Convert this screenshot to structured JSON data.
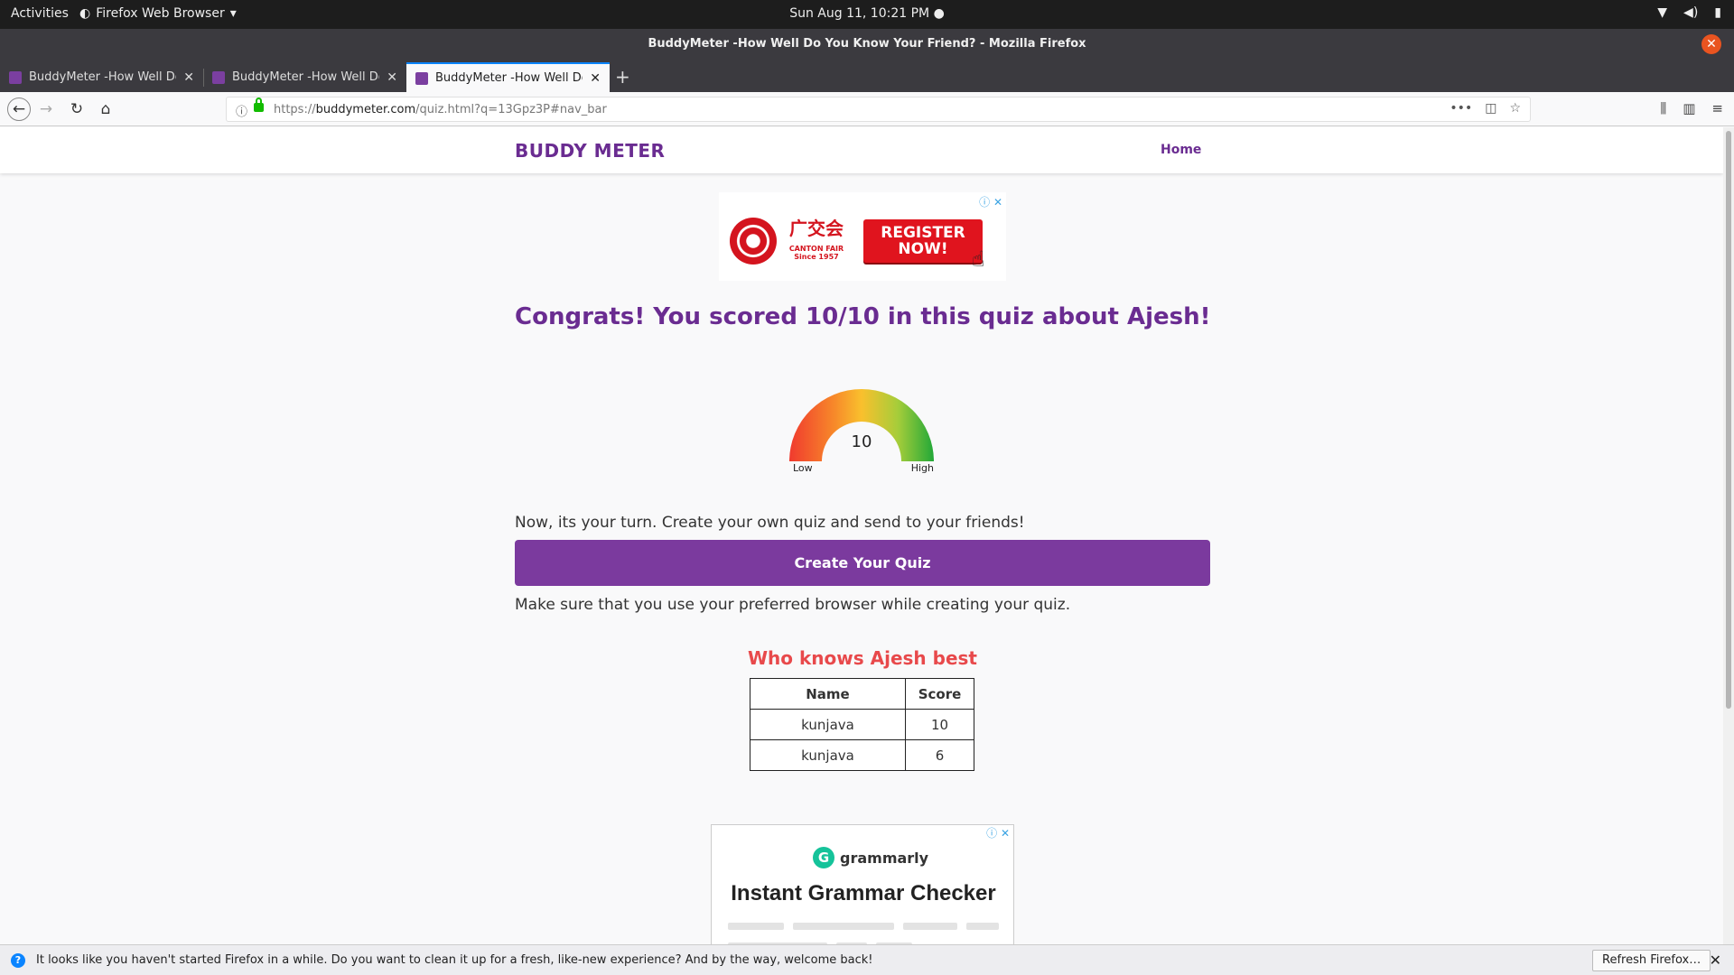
{
  "system": {
    "activities": "Activities",
    "app_name": "Firefox Web Browser",
    "clock": "Sun Aug 11, 10:21 PM"
  },
  "window": {
    "title": "BuddyMeter -How Well Do You Know Your Friend? - Mozilla Firefox"
  },
  "tabs": [
    {
      "label": "BuddyMeter -How Well Do You Know Your Friend?"
    },
    {
      "label": "BuddyMeter -How Well Do You Know Your Friend?"
    },
    {
      "label": "BuddyMeter -How Well Do You Know Your Friend?"
    }
  ],
  "navbar": {
    "url_prefix": "https://",
    "url_host": "buddymeter.com",
    "url_path": "/quiz.html?q=13Gpz3P#nav_bar"
  },
  "site": {
    "logo": "BUDDY METER",
    "home_link": "Home"
  },
  "ad_top": {
    "brand": "广交会",
    "brand_sub": "CANTON FAIR Since 1957",
    "cta": "REGISTER NOW!"
  },
  "result": {
    "congrats": "Congrats! You scored 10/10 in this quiz about Ajesh!",
    "score": "10",
    "gauge_low": "Low",
    "gauge_high": "High",
    "gauge_level": 1.0
  },
  "cta": {
    "intro": "Now, its your turn. Create your own quiz and send to your friends!",
    "button": "Create Your Quiz",
    "note": "Make sure that you use your preferred browser while creating your quiz."
  },
  "leaderboard": {
    "title": "Who knows Ajesh best",
    "headers": [
      "Name",
      "Score"
    ],
    "rows": [
      {
        "name": "kunjava",
        "score": "10"
      },
      {
        "name": "kunjava",
        "score": "6"
      }
    ]
  },
  "ad_bottom": {
    "brand": "grammarly",
    "headline": "Instant Grammar Checker"
  },
  "notification": {
    "message": "It looks like you haven't started Firefox in a while. Do you want to clean it up for a fresh, like-new experience? And by the way, welcome back!",
    "button": "Refresh Firefox…"
  },
  "colors": {
    "brand": "#6a2c91",
    "button": "#7b3a9e",
    "leaderboard_title": "#e8494b"
  }
}
